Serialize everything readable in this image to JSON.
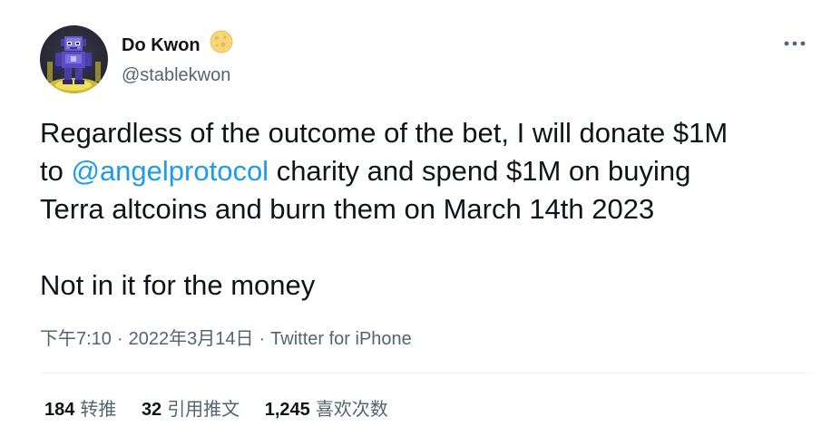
{
  "author": {
    "display_name": "Do Kwon",
    "handle": "@stablekwon",
    "avatar_icon": "pixel-robot-avatar",
    "badge_icon": "moon-emoji-icon"
  },
  "menu_icon": "more-horizontal-icon",
  "tweet": {
    "line1": "Regardless of the outcome of the bet, I will donate $1M",
    "line2_prefix": "to ",
    "mention": "@angelprotocol",
    "line2_suffix": " charity and spend $1M on buying",
    "line3": "Terra altcoins and burn them on March 14th 2023",
    "line4": "Not in it for the money"
  },
  "meta": {
    "time": "下午7:10",
    "separator": "·",
    "date": "2022年3月14日",
    "source": "Twitter for iPhone"
  },
  "stats": {
    "retweets": {
      "count": "184",
      "label": "转推"
    },
    "quotes": {
      "count": "32",
      "label": "引用推文"
    },
    "likes": {
      "count": "1,245",
      "label": "喜欢次数"
    }
  },
  "colors": {
    "text": "#0f1419",
    "secondary": "#536471",
    "link": "#1d9bf0",
    "divider": "#eff3f4"
  }
}
